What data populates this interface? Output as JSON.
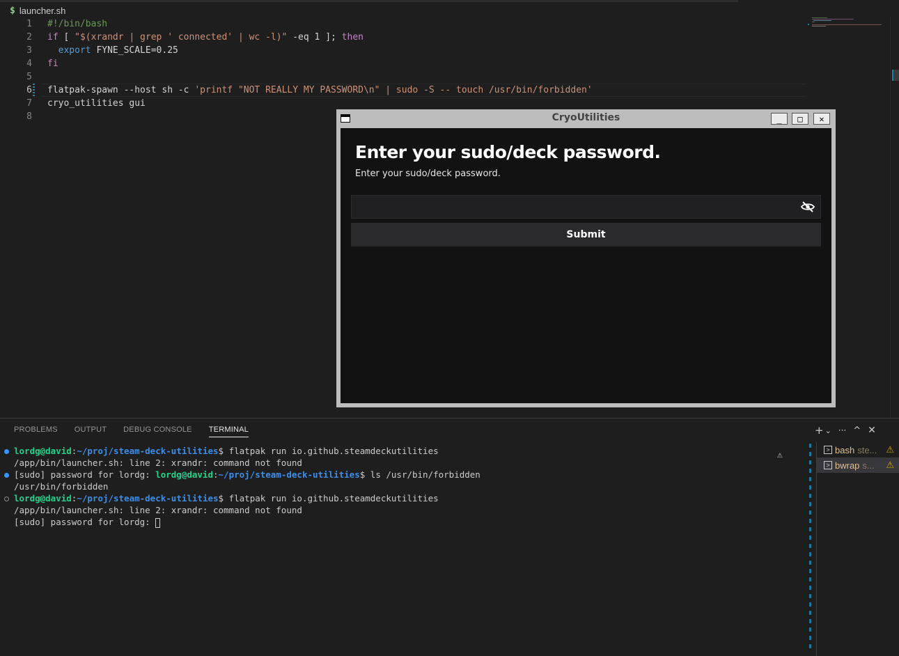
{
  "editor": {
    "tab_name": "launcher.sh",
    "tab_icon": "$",
    "line_numbers": [
      "1",
      "2",
      "3",
      "4",
      "5",
      "6",
      "7",
      "8"
    ],
    "lines": [
      "#!/bin/bash",
      "if [ \"$(xrandr | grep ' connected' | wc -l)\" -eq 1 ]; then",
      "  export FYNE_SCALE=0.25",
      "fi",
      "",
      "flatpak-spawn --host sh -c 'printf \"NOT REALLY MY PASSWORD\\n\" | sudo -S -- touch /usr/bin/forbidden'",
      "cryo_utilities gui",
      ""
    ]
  },
  "dialog": {
    "window_title": "CryoUtilities",
    "heading": "Enter your sudo/deck password.",
    "subtitle": "Enter your sudo/deck password.",
    "password_value": "",
    "submit_label": "Submit",
    "minimize_glyph": "_",
    "maximize_glyph": "□",
    "close_glyph": "✕"
  },
  "panel": {
    "tabs": [
      "PROBLEMS",
      "OUTPUT",
      "DEBUG CONSOLE",
      "TERMINAL"
    ],
    "active_tab": "TERMINAL",
    "actions": {
      "new_terminal": "+",
      "dropdown": "⌄",
      "more": "···",
      "maximize": "^",
      "close": "✕"
    }
  },
  "terminal": {
    "user": "lordg@david",
    "path": "~/proj/steam-deck-utilities",
    "cmd1": "flatpak run io.github.steamdeckutilities",
    "out1": "/app/bin/launcher.sh: line 2: xrandr: command not found",
    "sudo_prompt": "[sudo] password for lordg: ",
    "cmd2": "ls /usr/bin/forbidden",
    "out2": "/usr/bin/forbidden",
    "cmd3": "flatpak run io.github.steamdeckutilities",
    "out3": "/app/bin/launcher.sh: line 2: xrandr: command not found",
    "sudo_prompt2": "[sudo] password for lordg: "
  },
  "terminal_list": [
    {
      "name": "bash",
      "detail": "ste...",
      "warn": "⚠"
    },
    {
      "name": "bwrap",
      "detail": "s...",
      "warn": "⚠"
    }
  ],
  "colors": {
    "accent": "#3794ff",
    "prompt_user": "#23d18b",
    "prompt_path": "#3b8eea",
    "warning": "#cca700"
  }
}
